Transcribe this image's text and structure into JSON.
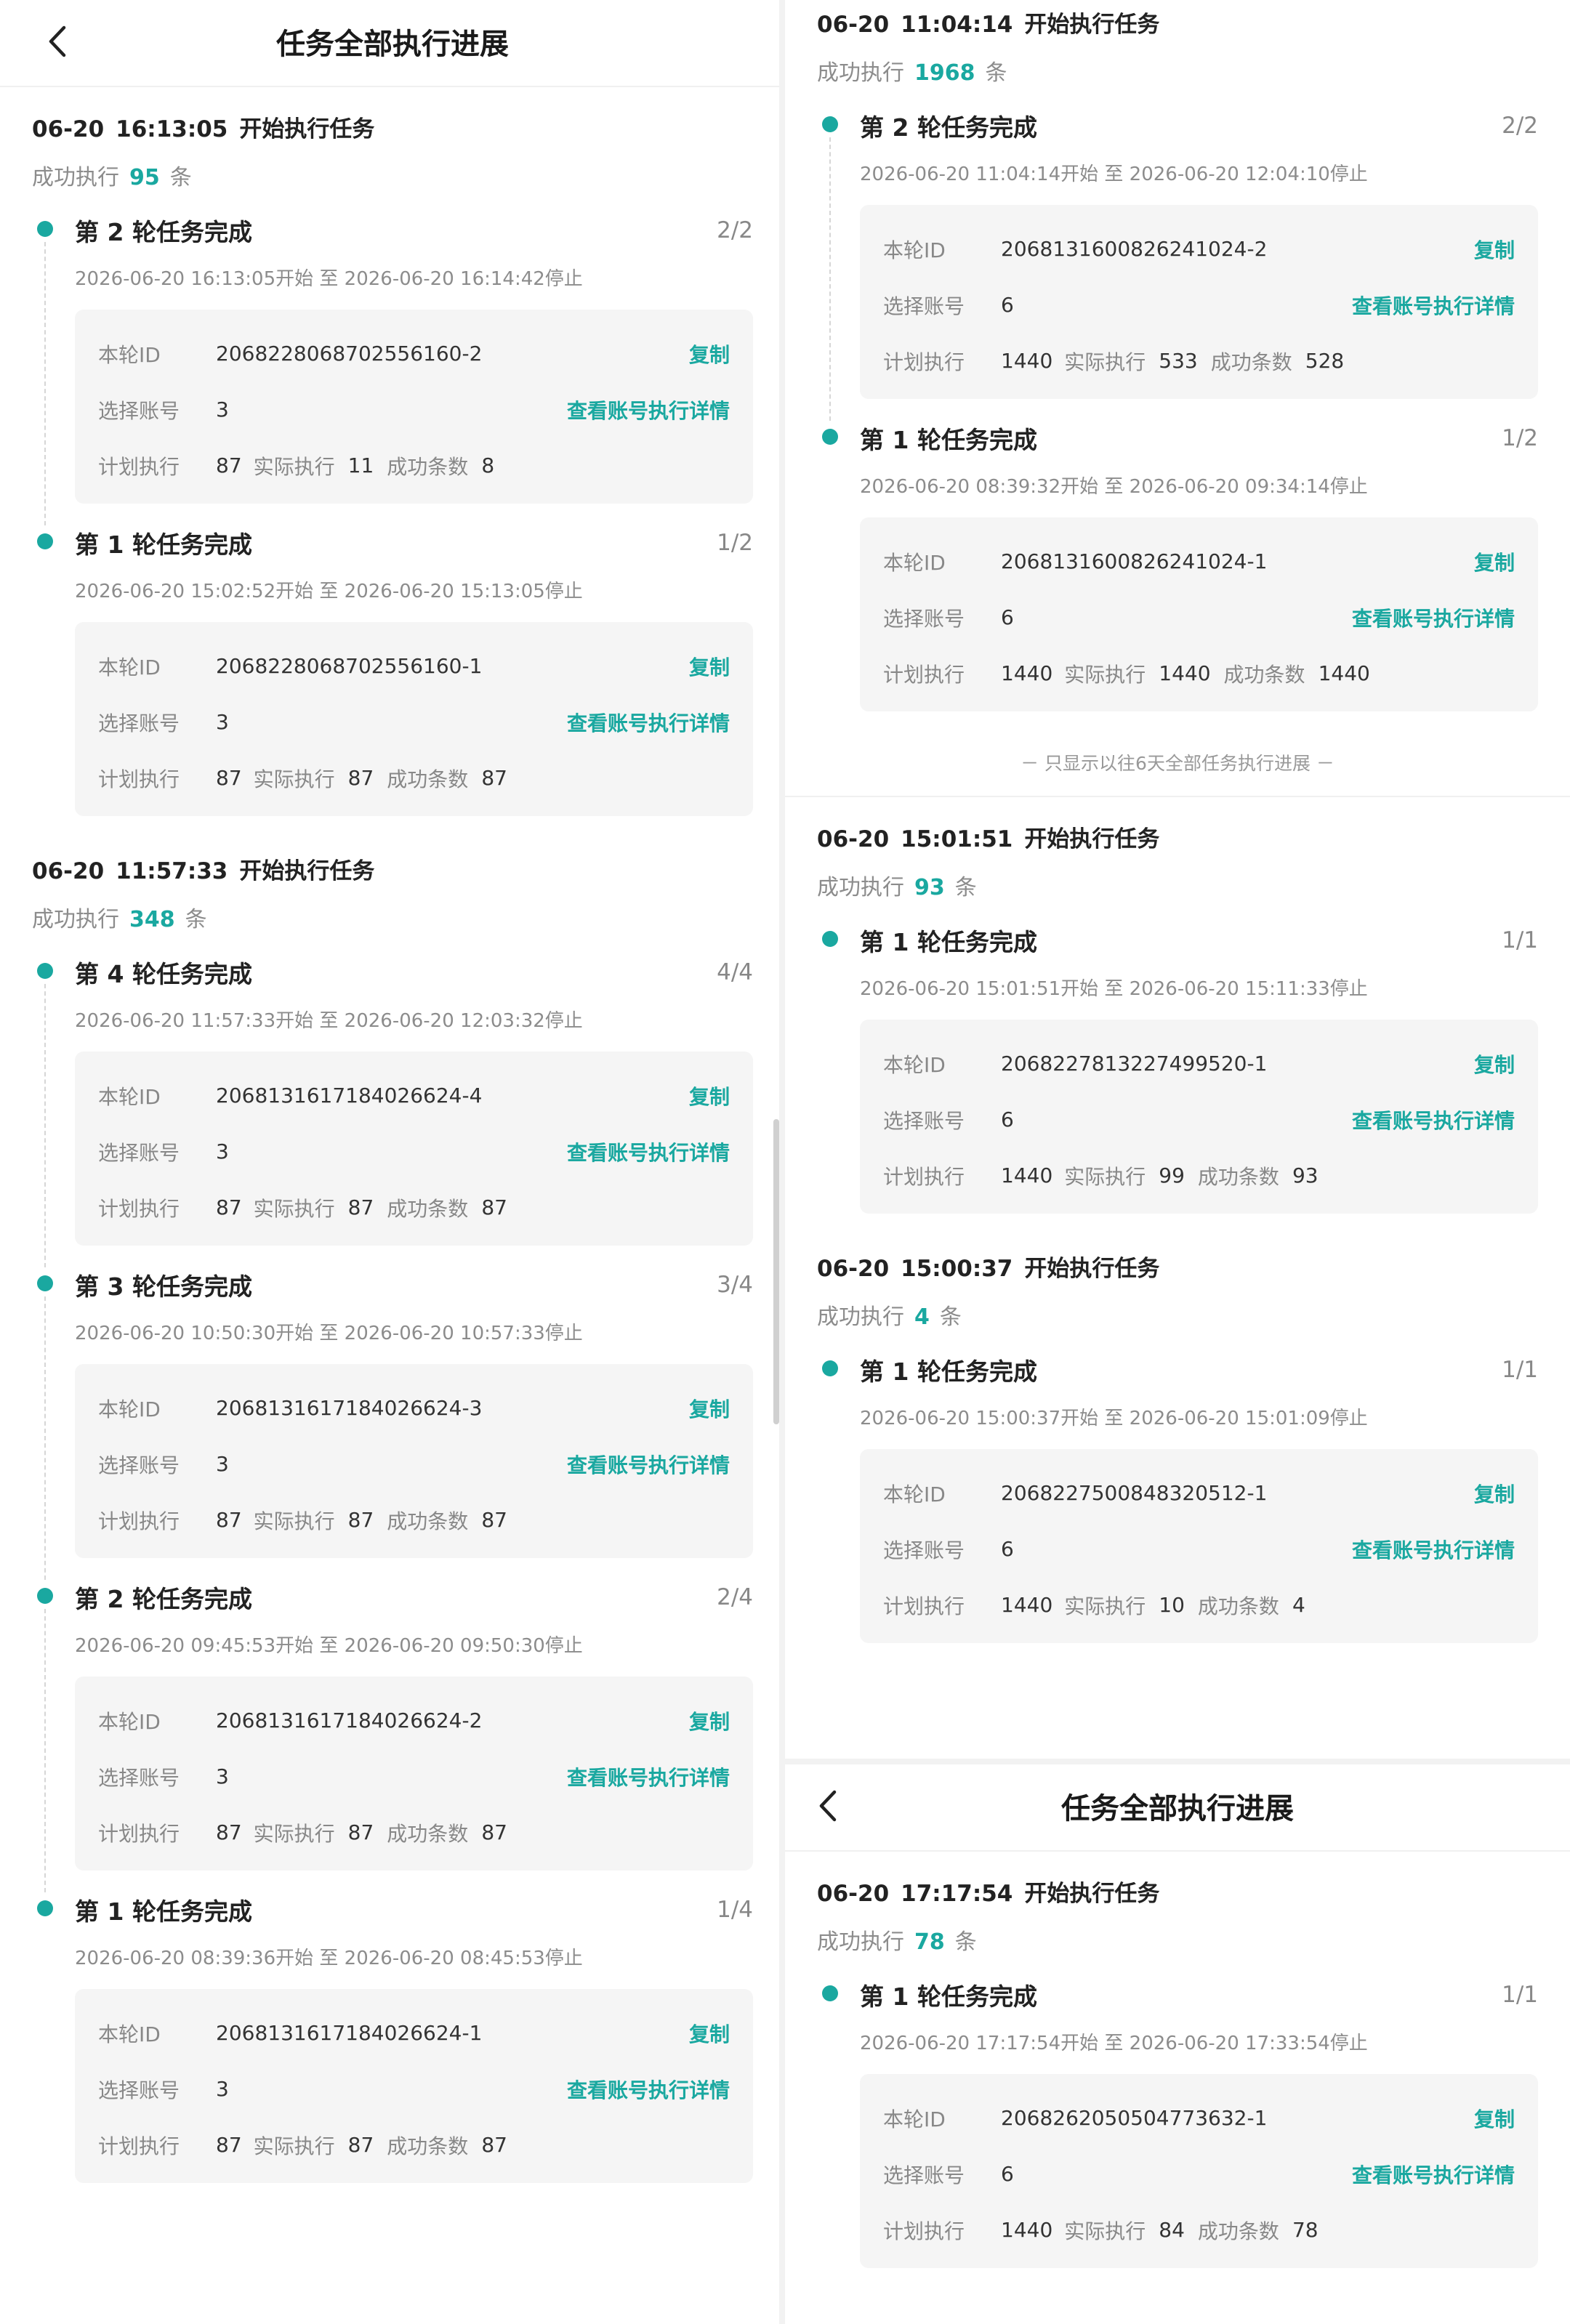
{
  "header": {
    "title": "任务全部执行进展"
  },
  "labels": {
    "task_start": "开始执行任务",
    "success_prefix": "成功执行",
    "success_suffix": "条",
    "round_id": "本轮ID",
    "copy": "复制",
    "select_account": "选择账号",
    "view_detail": "查看账号执行详情",
    "plan": "计划执行",
    "actual": "实际执行",
    "success_count": "成功条数",
    "time_start": "开始",
    "time_to": "至",
    "time_stop": "停止"
  },
  "footer_note": "－ 只显示以往6天全部任务执行进展 －",
  "left": {
    "tasks": [
      {
        "date": "06-20",
        "time": "16:13:05",
        "success": "95",
        "rounds": [
          {
            "title": "第 2 轮任务完成",
            "frac": "2/2",
            "start": "2026-06-20 16:13:05",
            "end": "2026-06-20 16:14:42",
            "id": "2068228068702556160-2",
            "accounts": "3",
            "plan": "87",
            "actual": "11",
            "succ": "8"
          },
          {
            "title": "第 1 轮任务完成",
            "frac": "1/2",
            "start": "2026-06-20 15:02:52",
            "end": "2026-06-20 15:13:05",
            "id": "2068228068702556160-1",
            "accounts": "3",
            "plan": "87",
            "actual": "87",
            "succ": "87"
          }
        ]
      },
      {
        "date": "06-20",
        "time": "11:57:33",
        "success": "348",
        "rounds": [
          {
            "title": "第 4 轮任务完成",
            "frac": "4/4",
            "start": "2026-06-20 11:57:33",
            "end": "2026-06-20 12:03:32",
            "id": "2068131617184026624-4",
            "accounts": "3",
            "plan": "87",
            "actual": "87",
            "succ": "87"
          },
          {
            "title": "第 3 轮任务完成",
            "frac": "3/4",
            "start": "2026-06-20 10:50:30",
            "end": "2026-06-20 10:57:33",
            "id": "2068131617184026624-3",
            "accounts": "3",
            "plan": "87",
            "actual": "87",
            "succ": "87"
          },
          {
            "title": "第 2 轮任务完成",
            "frac": "2/4",
            "start": "2026-06-20 09:45:53",
            "end": "2026-06-20 09:50:30",
            "id": "2068131617184026624-2",
            "accounts": "3",
            "plan": "87",
            "actual": "87",
            "succ": "87"
          },
          {
            "title": "第 1 轮任务完成",
            "frac": "1/4",
            "start": "2026-06-20 08:39:36",
            "end": "2026-06-20 08:45:53",
            "id": "2068131617184026624-1",
            "accounts": "3",
            "plan": "87",
            "actual": "87",
            "succ": "87"
          }
        ]
      }
    ]
  },
  "right_top": {
    "tasks": [
      {
        "date": "06-20",
        "time": "11:04:14",
        "success": "1968",
        "rounds": [
          {
            "title": "第 2 轮任务完成",
            "frac": "2/2",
            "start": "2026-06-20 11:04:14",
            "end": "2026-06-20 12:04:10",
            "id": "2068131600826241024-2",
            "accounts": "6",
            "plan": "1440",
            "actual": "533",
            "succ": "528"
          },
          {
            "title": "第 1 轮任务完成",
            "frac": "1/2",
            "start": "2026-06-20 08:39:32",
            "end": "2026-06-20 09:34:14",
            "id": "2068131600826241024-1",
            "accounts": "6",
            "plan": "1440",
            "actual": "1440",
            "succ": "1440"
          }
        ]
      }
    ]
  },
  "right_mid": {
    "tasks": [
      {
        "date": "06-20",
        "time": "15:01:51",
        "success": "93",
        "rounds": [
          {
            "title": "第 1 轮任务完成",
            "frac": "1/1",
            "start": "2026-06-20 15:01:51",
            "end": "2026-06-20 15:11:33",
            "id": "2068227813227499520-1",
            "accounts": "6",
            "plan": "1440",
            "actual": "99",
            "succ": "93"
          }
        ]
      },
      {
        "date": "06-20",
        "time": "15:00:37",
        "success": "4",
        "rounds": [
          {
            "title": "第 1 轮任务完成",
            "frac": "1/1",
            "start": "2026-06-20 15:00:37",
            "end": "2026-06-20 15:01:09",
            "id": "2068227500848320512-1",
            "accounts": "6",
            "plan": "1440",
            "actual": "10",
            "succ": "4"
          }
        ]
      }
    ]
  },
  "right_bottom": {
    "tasks": [
      {
        "date": "06-20",
        "time": "17:17:54",
        "success": "78",
        "rounds": [
          {
            "title": "第 1 轮任务完成",
            "frac": "1/1",
            "start": "2026-06-20 17:17:54",
            "end": "2026-06-20 17:33:54",
            "id": "2068262050504773632-1",
            "accounts": "6",
            "plan": "1440",
            "actual": "84",
            "succ": "78"
          }
        ]
      }
    ]
  },
  "colors": {
    "accent": "#1aa8a0"
  }
}
